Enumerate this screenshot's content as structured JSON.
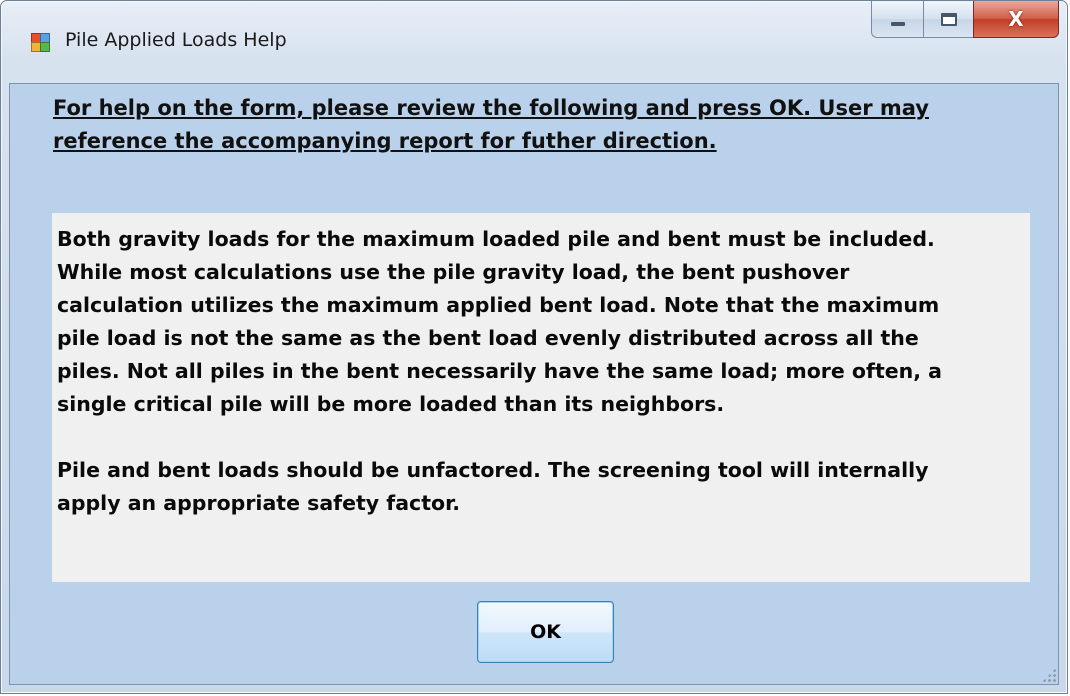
{
  "window": {
    "title": "Pile Applied Loads Help",
    "icon": "app-form-icon",
    "controls": {
      "minimize_icon": "minimize-icon",
      "maximize_icon": "maximize-icon",
      "close_glyph": "X"
    }
  },
  "help": {
    "header_line1": "For help on the form, please review the following and press OK.  User may",
    "header_line2": "reference the accompanying report for futher direction.",
    "paragraph1": "Both gravity loads for the maximum loaded pile and bent must be included.\nWhile most calculations use the pile gravity load, the bent pushover\ncalculation utilizes the maximum applied bent load.  Note that the maximum\npile load is not the same as the bent load evenly distributed across all the\npiles.  Not all piles in the bent necessarily have the same load; more often, a\nsingle critical pile will be more loaded than its neighbors.",
    "paragraph2": "Pile and bent loads should be unfactored.  The screening tool will internally\napply an appropriate safety factor."
  },
  "buttons": {
    "ok_label": "OK"
  },
  "colors": {
    "client_background": "#b9d1ea",
    "text_box_background": "#f0f0f0",
    "close_button": "#c13f25"
  }
}
